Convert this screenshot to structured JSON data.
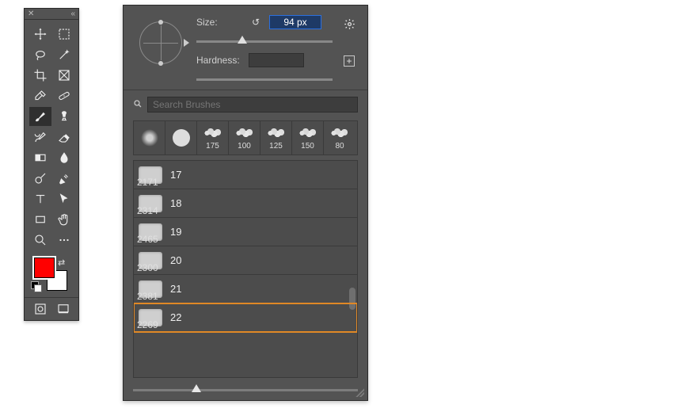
{
  "tools_panel": {
    "header": {
      "close_glyph": "✕",
      "collapse_glyph": "«"
    },
    "tools": [
      {
        "name": "move-tool",
        "glyph": "move"
      },
      {
        "name": "marquee-tool",
        "glyph": "marquee"
      },
      {
        "name": "lasso-tool",
        "glyph": "lasso"
      },
      {
        "name": "magic-wand-tool",
        "glyph": "wand"
      },
      {
        "name": "crop-tool",
        "glyph": "crop"
      },
      {
        "name": "frame-tool",
        "glyph": "frame"
      },
      {
        "name": "eyedropper-tool",
        "glyph": "eyedrop"
      },
      {
        "name": "healing-brush-tool",
        "glyph": "bandaid"
      },
      {
        "name": "brush-tool",
        "glyph": "brush",
        "selected": true
      },
      {
        "name": "clone-stamp-tool",
        "glyph": "stamp"
      },
      {
        "name": "history-brush-tool",
        "glyph": "histbrush"
      },
      {
        "name": "eraser-tool",
        "glyph": "eraser"
      },
      {
        "name": "gradient-tool",
        "glyph": "gradient"
      },
      {
        "name": "blur-tool",
        "glyph": "blur"
      },
      {
        "name": "dodge-tool",
        "glyph": "dodge"
      },
      {
        "name": "pen-tool",
        "glyph": "pen"
      },
      {
        "name": "type-tool",
        "glyph": "type"
      },
      {
        "name": "path-select-tool",
        "glyph": "arrow"
      },
      {
        "name": "rectangle-tool",
        "glyph": "rect"
      },
      {
        "name": "hand-tool",
        "glyph": "hand"
      },
      {
        "name": "zoom-tool",
        "glyph": "zoom"
      },
      {
        "name": "edit-toolbar",
        "glyph": "dots"
      }
    ],
    "swatches": {
      "foreground": "#ff0000",
      "background": "#ffffff"
    },
    "footer": [
      {
        "name": "quick-mask-toggle",
        "glyph": "quickmask"
      },
      {
        "name": "screen-mode-toggle",
        "glyph": "screenmode"
      }
    ]
  },
  "brush_panel": {
    "size": {
      "label": "Size:",
      "value": "94 px"
    },
    "hardness": {
      "label": "Hardness:",
      "value": ""
    },
    "gear_glyph": "✿",
    "plus_glyph": "+",
    "reset_glyph": "↺",
    "search": {
      "placeholder": "Search Brushes"
    },
    "recent_tips": [
      {
        "name": "soft-round",
        "label": "",
        "kind": "soft"
      },
      {
        "name": "hard-round",
        "label": "",
        "kind": "hard"
      },
      {
        "name": "tip-175",
        "label": "175",
        "kind": "stroke"
      },
      {
        "name": "tip-100",
        "label": "100",
        "kind": "stroke"
      },
      {
        "name": "tip-125",
        "label": "125",
        "kind": "stroke"
      },
      {
        "name": "tip-150",
        "label": "150",
        "kind": "stroke"
      },
      {
        "name": "tip-80",
        "label": "80",
        "kind": "stroke"
      }
    ],
    "brushes": [
      {
        "name": "17",
        "px": "2171"
      },
      {
        "name": "18",
        "px": "2314"
      },
      {
        "name": "19",
        "px": "2465"
      },
      {
        "name": "20",
        "px": "2300"
      },
      {
        "name": "21",
        "px": "2381"
      },
      {
        "name": "22",
        "px": "2269",
        "selected": true
      }
    ]
  }
}
